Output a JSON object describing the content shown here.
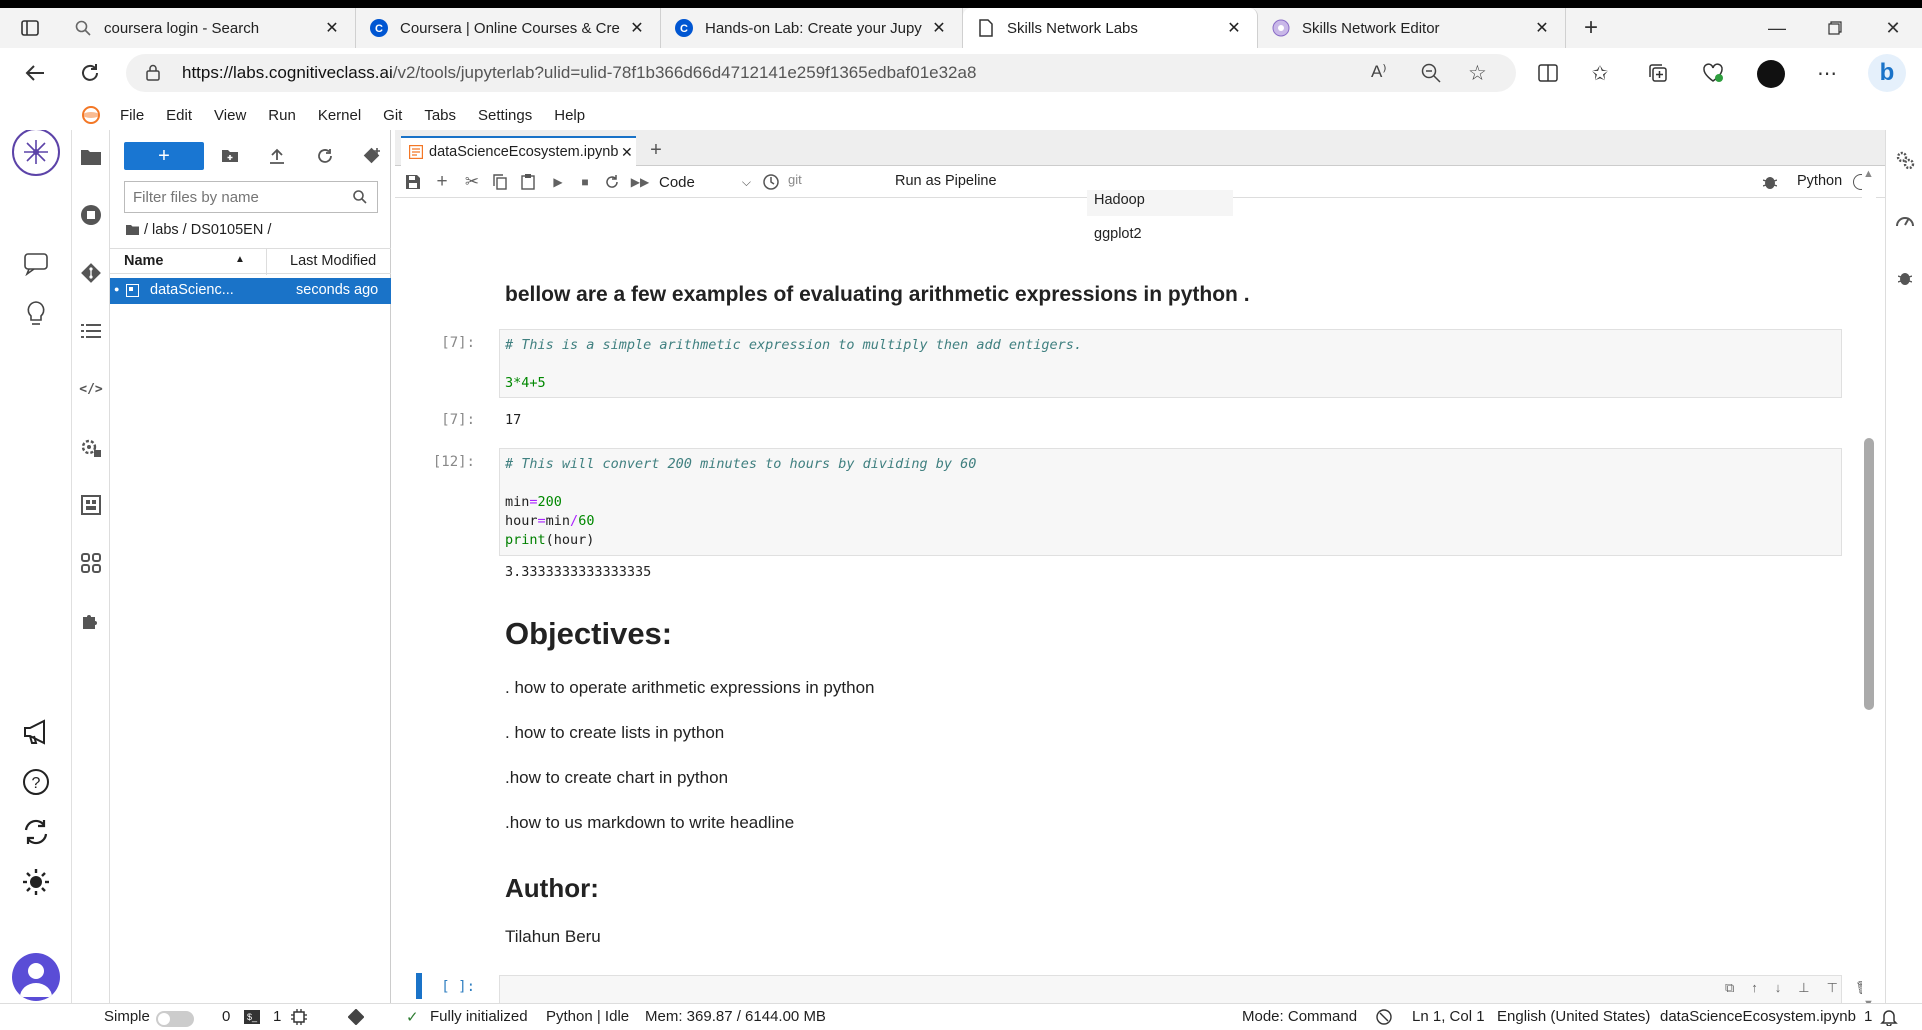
{
  "browser": {
    "tabs": [
      {
        "title": "coursera login - Search",
        "icon": "search-icon"
      },
      {
        "title": "Coursera | Online Courses & Crec",
        "icon": "coursera-icon"
      },
      {
        "title": "Hands-on Lab: Create your Jupyt",
        "icon": "coursera-icon"
      },
      {
        "title": "Skills Network Labs",
        "icon": "page-icon"
      },
      {
        "title": "Skills Network Editor",
        "icon": "editor-icon"
      }
    ],
    "url_host": "https://labs.cognitiveclass.ai",
    "url_path": "/v2/tools/jupyterlab?ulid=ulid-78f1b366d66d4712141e259f1365edbaf01e32a8"
  },
  "menu": [
    "File",
    "Edit",
    "View",
    "Run",
    "Kernel",
    "Git",
    "Tabs",
    "Settings",
    "Help"
  ],
  "filebrowser": {
    "new_label": "+",
    "filter_placeholder": "Filter files by name",
    "breadcrumb": "/ labs / DS0105EN /",
    "col_name": "Name",
    "col_modified": "Last Modified",
    "files": [
      {
        "name": "dataScienc...",
        "modified": "seconds ago"
      }
    ]
  },
  "notebook": {
    "tab_title": "dataScienceEcosystem.ipynb",
    "cell_type": "Code",
    "git_label": "git",
    "pipeline_label": "Run as Pipeline",
    "kernel_label": "Python",
    "table_tail": [
      "Hadoop",
      "ggplot2"
    ],
    "heading1": "bellow are a few examples of evaluating arithmetic expressions in python .",
    "cell7_prompt": "[7]:",
    "cell7_comment": "# This is a simple arithmetic expression to multiply then add entigers.",
    "cell7_code": "3*4+5",
    "out7_prompt": "[7]:",
    "out7": "17",
    "cell12_prompt": "[12]:",
    "cell12_comment": "# This will convert 200 minutes to hours by dividing by 60",
    "cell12_line1_a": "min",
    "cell12_line1_b": "=",
    "cell12_line1_c": "200",
    "cell12_line2_a": "hour",
    "cell12_line2_b": "=",
    "cell12_line2_c": "min",
    "cell12_line2_d": "/",
    "cell12_line2_e": "60",
    "cell12_line3_a": "print",
    "cell12_line3_b": "(hour)",
    "out12": "3.3333333333333335",
    "objectives_title": "Objectives:",
    "objectives": [
      ". how to operate arithmetic expressions in python",
      ". how to create lists in python",
      ".how to create chart in python",
      ".how to us markdown to write headline"
    ],
    "author_title": "Author:",
    "author": "Tilahun Beru",
    "empty_prompt": "[ ]:"
  },
  "status": {
    "mode_simple": "Simple",
    "terminals": "0",
    "kernels": "1",
    "init": "Fully initialized",
    "kernel_state": "Python | Idle",
    "mem": "Mem: 369.87 / 6144.00 MB",
    "mode": "Mode: Command",
    "pos": "Ln 1, Col 1",
    "lang": "English (United States)",
    "file": "dataScienceEcosystem.ipynb",
    "count": "1"
  }
}
